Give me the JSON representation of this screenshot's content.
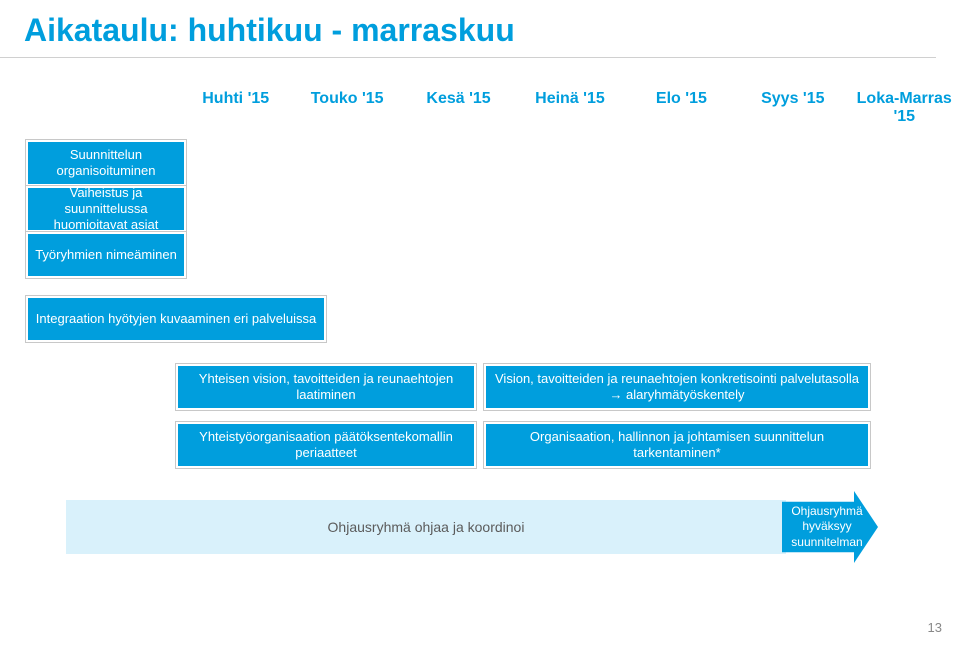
{
  "title": "Aikataulu: huhtikuu - marraskuu",
  "months": [
    "Huhti '15",
    "Touko '15",
    "Kesä '15",
    "Heinä '15",
    "Elo '15",
    "Syys '15",
    "Loka-Marras '15"
  ],
  "bars": {
    "suunnittelun": "Suunnittelun organisoituminen",
    "vaiheistus": "Vaiheistus ja suunnittelussa huomioitavat asiat",
    "tyoryhmien": "Työryhmien nimeäminen",
    "integraation": "Integraation hyötyjen kuvaaminen eri palveluissa",
    "yhteisen_vision": "Yhteisen vision, tavoitteiden ja reunaehtojen laatiminen",
    "yhteistyoorg": "Yhteistyöorganisaation päätöksentekomallin periaatteet",
    "vision_r": "Vision, tavoitteiden ja reunaehtojen konkretisointi palvelutasolla → alaryhmätyöskentely",
    "org_r": "Organisaation, hallinnon ja johtamisen suunnittelun tarkentaminen*"
  },
  "bottom": {
    "band": "Ohjausryhmä ohjaa ja koordinoi",
    "arrow": "Ohjausryhmä hyväksyy suunnitelman"
  },
  "page": "13"
}
